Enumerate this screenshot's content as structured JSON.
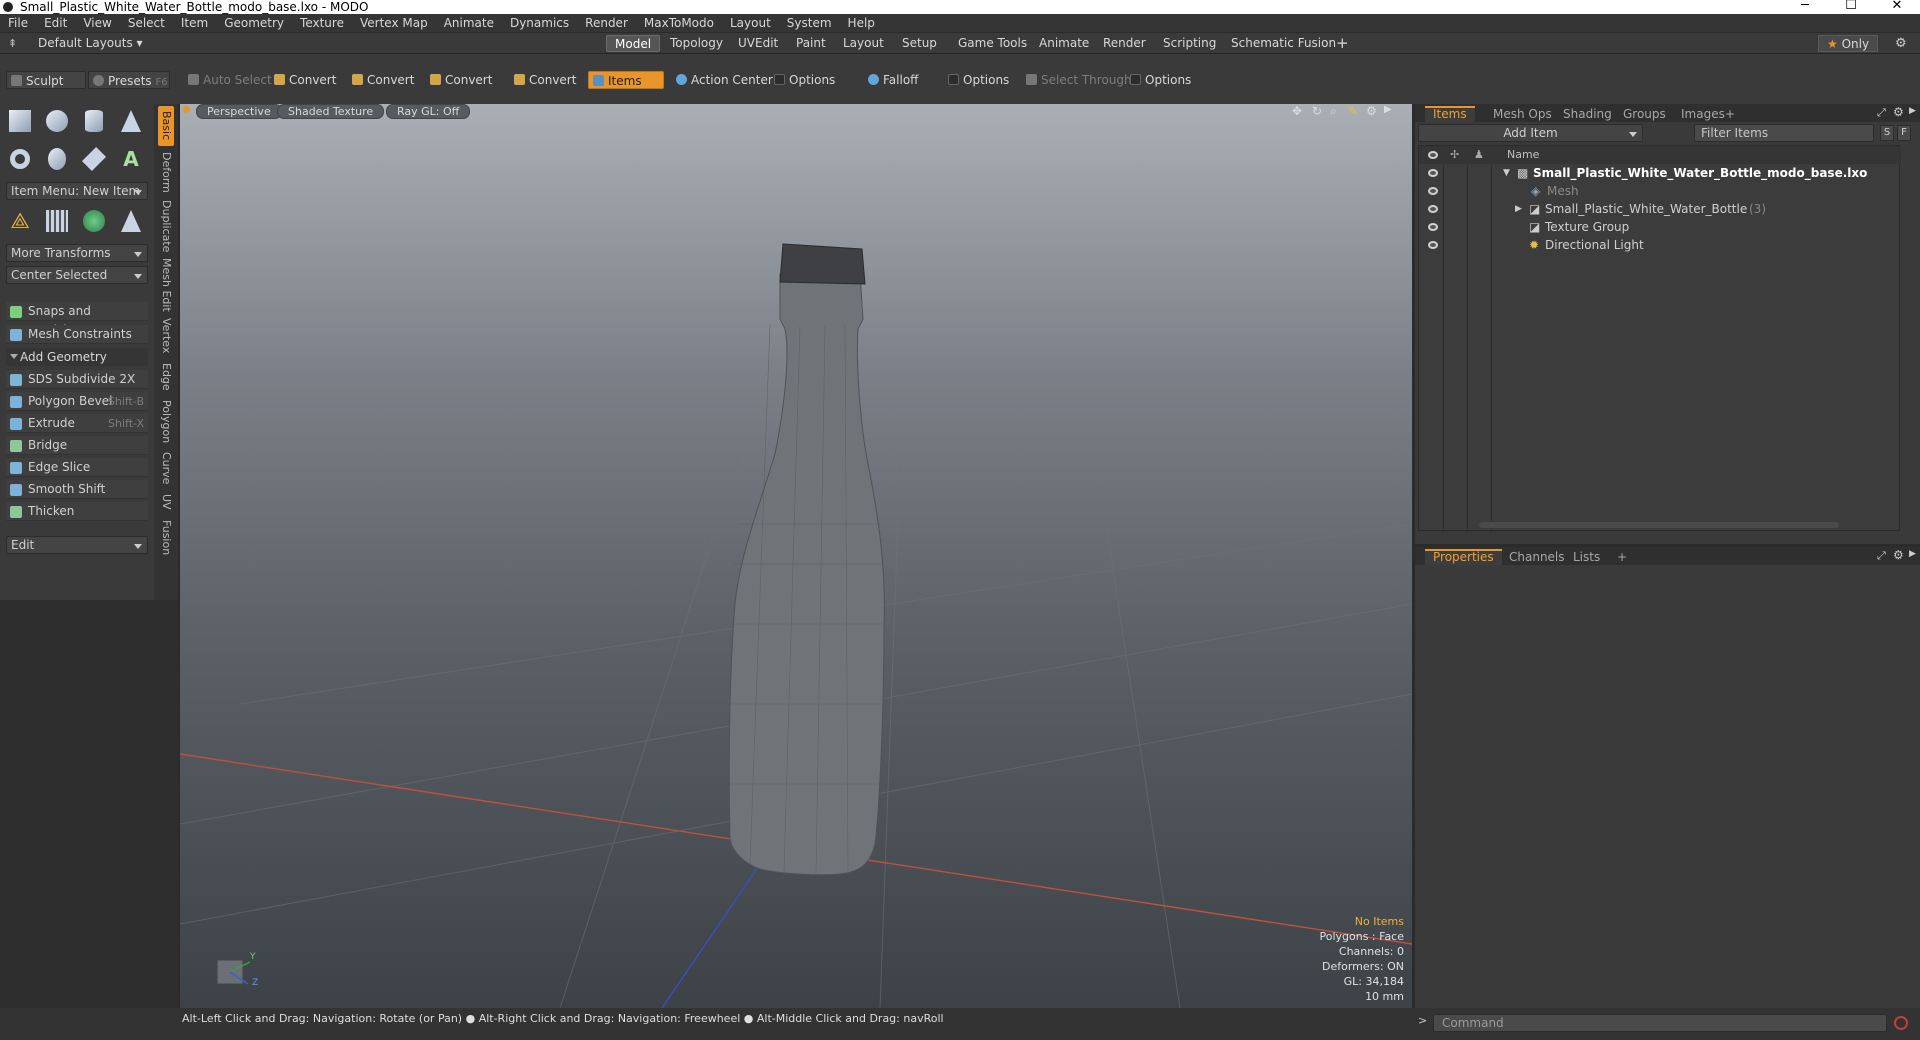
{
  "window": {
    "title": "Small_Plastic_White_Water_Bottle_modo_base.lxo - MODO",
    "minimize": "─",
    "maximize": "☐",
    "close": "✕"
  },
  "menu": [
    "File",
    "Edit",
    "View",
    "Select",
    "Item",
    "Geometry",
    "Texture",
    "Vertex Map",
    "Animate",
    "Dynamics",
    "Render",
    "MaxToModo",
    "Layout",
    "System",
    "Help"
  ],
  "layout": {
    "default_layouts": "Default Layouts",
    "tabs": [
      "Model",
      "Topology",
      "UVEdit",
      "Paint",
      "Layout",
      "Setup",
      "Game Tools",
      "Animate",
      "Render",
      "Scripting",
      "Schematic Fusion"
    ],
    "active_tab": "Model",
    "plus": "+",
    "only": "Only"
  },
  "toolbar": {
    "sculpt": "Sculpt",
    "presets": "Presets",
    "presets_key": "F6",
    "auto_select": "Auto Select",
    "convert1": "Convert",
    "convert2": "Convert",
    "convert3": "Convert",
    "convert4": "Convert",
    "items": "Items",
    "action_center": "Action Center",
    "options1": "Options",
    "falloff": "Falloff",
    "options2": "Options",
    "select_through": "Select Through",
    "options3": "Options"
  },
  "left_panel": {
    "vertical_tabs": [
      "Basic",
      "Deform",
      "Duplicate",
      "Mesh Edit",
      "Vertex",
      "Edge",
      "Polygon",
      "Curve",
      "UV",
      "Fusion"
    ],
    "item_menu": "Item Menu: New Item",
    "more_transforms": "More Transforms",
    "center_selected": "Center Selected",
    "snaps": "Snaps and Precision",
    "mesh_constraints": "Mesh Constraints",
    "add_geometry": "Add Geometry",
    "tools": [
      {
        "label": "SDS Subdivide 2X",
        "shortcut": ""
      },
      {
        "label": "Polygon Bevel",
        "shortcut": "Shift-B"
      },
      {
        "label": "Extrude",
        "shortcut": "Shift-X"
      },
      {
        "label": "Bridge",
        "shortcut": ""
      },
      {
        "label": "Edge Slice",
        "shortcut": ""
      },
      {
        "label": "Smooth Shift",
        "shortcut": ""
      },
      {
        "label": "Thicken",
        "shortcut": ""
      }
    ],
    "edit": "Edit"
  },
  "viewport": {
    "perspective": "Perspective",
    "shaded": "Shaded Texture",
    "raygl": "Ray GL: Off",
    "hud": {
      "no_items": "No Items",
      "polygons": "Polygons : Face",
      "channels": "Channels: 0",
      "deformers": "Deformers: ON",
      "gl": "GL: 34,184",
      "scale": "10 mm"
    },
    "axis_y": "Y",
    "axis_z": "Z"
  },
  "items_panel": {
    "tabs": [
      "Items",
      "Mesh Ops",
      "Shading",
      "Groups",
      "Images"
    ],
    "plus": "+",
    "add_item": "Add Item",
    "filter": "Filter Items",
    "s": "S",
    "f": "F",
    "name_col": "Name",
    "tree": [
      {
        "label": "Small_Plastic_White_Water_Bottle_modo_base.lxo",
        "count": "",
        "indent": 0
      },
      {
        "label": "Mesh",
        "count": "",
        "indent": 1
      },
      {
        "label": "Small_Plastic_White_Water_Bottle",
        "count": "(3)",
        "indent": 1
      },
      {
        "label": "Texture Group",
        "count": "",
        "indent": 1
      },
      {
        "label": "Directional Light",
        "count": "",
        "indent": 1
      }
    ]
  },
  "properties_panel": {
    "tabs": [
      "Properties",
      "Channels",
      "Lists"
    ],
    "plus": "+"
  },
  "status": {
    "message": "Alt-Left Click and Drag: Navigation: Rotate (or Pan) ● Alt-Right Click and Drag: Navigation: Freewheel ● Alt-Middle Click and Drag: navRoll",
    "command_placeholder": "Command"
  },
  "colors": {
    "accent": "#e8952a",
    "panel": "#3a3a3a",
    "hud_warn": "#f0b03a"
  }
}
